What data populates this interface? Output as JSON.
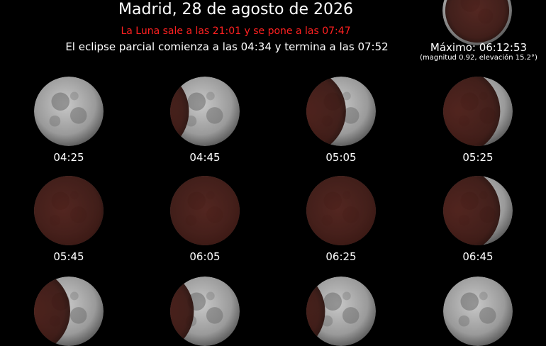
{
  "title": "Madrid, 28 de agosto de 2026",
  "moonrise_text": "La Luna sale a las 21:01 y se pone a las 07:47",
  "eclipse_text": "El eclipse parcial comienza a las 04:34 y termina a las 07:52",
  "maximum": {
    "label": "Máximo: 06:12:53",
    "details": "(magnitud 0.92, elevación 15.2°)"
  },
  "colors": {
    "background": "#000000",
    "moonrise_text": "#ff2020",
    "text": "#ffffff"
  },
  "moons": [
    {
      "time": "04:25",
      "shadow": 0.0
    },
    {
      "time": "04:45",
      "shadow": 0.05
    },
    {
      "time": "05:05",
      "shadow": 0.35
    },
    {
      "time": "05:25",
      "shadow": 0.6
    },
    {
      "time": "05:45",
      "shadow": 0.82
    },
    {
      "time": "06:05",
      "shadow": 0.92
    },
    {
      "time": "06:25",
      "shadow": 0.85
    },
    {
      "time": "06:45",
      "shadow": 0.6
    },
    {
      "time": "",
      "shadow": 0.3
    },
    {
      "time": "",
      "shadow": 0.12
    },
    {
      "time": "",
      "shadow": 0.05
    },
    {
      "time": "",
      "shadow": 0.0
    }
  ]
}
